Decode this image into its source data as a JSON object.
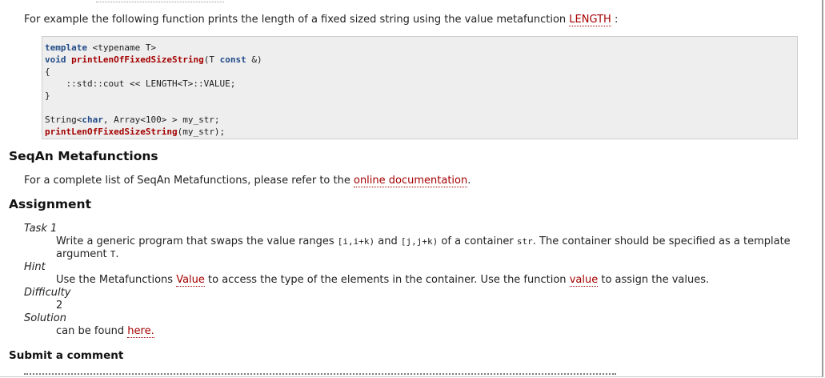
{
  "intro": {
    "text": "For example the following function prints the length of a fixed sized string using the value metafunction",
    "link": "LENGTH",
    "suffix": ":"
  },
  "code": {
    "line1_kw": "template",
    "line1_rest": " <typename T>",
    "line2_kw": "void",
    "line2_fn": "printLenOfFixedSizeString",
    "line2_mid": "(T ",
    "line2_kw2": "const",
    "line2_end": " &)",
    "line3": "{",
    "line4": "    ::std::cout << LENGTH<T>::VALUE;",
    "line5": "}",
    "line7_a": "String<",
    "line7_kw": "char",
    "line7_b": ", Array<100> > my_str;",
    "line8_fn": "printLenOfFixedSizeString",
    "line8_rest": "(my_str);"
  },
  "seqan_section": {
    "heading": "SeqAn Metafunctions",
    "text": "For a complete list of SeqAn Metafunctions, please refer to the",
    "link": "online documentation",
    "suffix": "."
  },
  "assignment": {
    "heading": "Assignment",
    "task_label": "Task 1",
    "task_text_a": "Write a generic program that swaps the value ranges",
    "task_code1": "[i,i+k)",
    "task_text_b": "and",
    "task_code2": "[j,j+k)",
    "task_text_c": "of a container",
    "task_code3": "str",
    "task_text_d": ". The container should be specified as a template argument",
    "task_code4": "T",
    "task_text_e": ".",
    "hint_label": "Hint",
    "hint_text_a": "Use the Metafunctions",
    "hint_link1": "Value",
    "hint_text_b": "to access the type of the elements in the container. Use the function",
    "hint_link2": "value",
    "hint_text_c": "to assign the values.",
    "difficulty_label": "Difficulty",
    "difficulty_value": "2",
    "solution_label": "Solution",
    "solution_text": "can be found",
    "solution_link": "here."
  },
  "comment_heading": "Submit a comment",
  "colors": {
    "link": "#a40000",
    "keyword": "#204a87",
    "code_bg": "#eeeeee"
  }
}
